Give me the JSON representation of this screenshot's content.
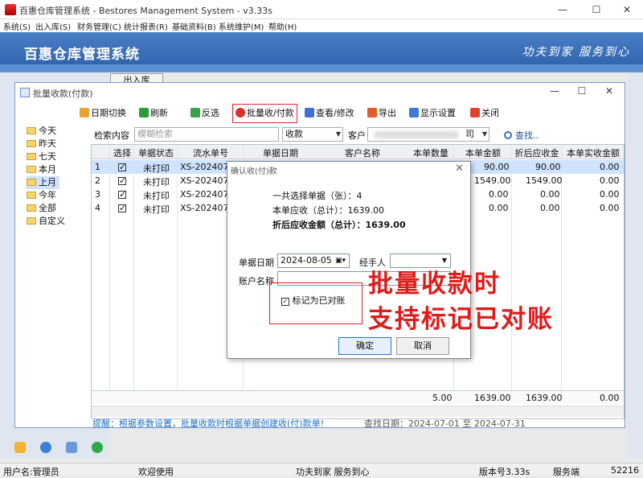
{
  "window": {
    "title": "百惠仓库管理系统 - Bestores Management System - v3.33s",
    "controls": [
      "—",
      "☐",
      "✕"
    ]
  },
  "menu": [
    "系统(S)",
    "出入库(S)",
    "财务管理(C)",
    "统计报表(R)",
    "基础资料(B)",
    "系统维护(M)",
    "帮助(H)"
  ],
  "banner": {
    "title": "百惠仓库管理系统",
    "slogan": "功夫到家 服务到心"
  },
  "tab_inbound": "出入库",
  "inner_window": {
    "title": "批量收款(付款)",
    "toolbar": [
      {
        "label": "日期切换",
        "icon": "calendar-icon",
        "color": "#e8a531"
      },
      {
        "label": "刷新",
        "icon": "refresh-icon",
        "color": "#2a9d3b"
      },
      {
        "label": "反选",
        "icon": "invert-icon",
        "color": "#3aa34a"
      },
      {
        "label": "批量收/付款",
        "icon": "batch-pay-icon",
        "color": "#d8312a"
      },
      {
        "label": "查看/修改",
        "icon": "view-edit-icon",
        "color": "#3f6fd1"
      },
      {
        "label": "导出",
        "icon": "export-icon",
        "color": "#e25b2a"
      },
      {
        "label": "显示设置",
        "icon": "settings-icon",
        "color": "#3a7bd5"
      },
      {
        "label": "关闭",
        "icon": "close-icon",
        "color": "#e0432f"
      }
    ],
    "tree": [
      "今天",
      "昨天",
      "七天",
      "本月",
      "上月",
      "今年",
      "全部",
      "自定义"
    ],
    "tree_active": "上月",
    "filter": {
      "search_label": "检索内容",
      "search_placeholder": "模糊检索",
      "type_value": "收款",
      "customer_label": "客户",
      "customer_value": "司",
      "search_btn": "查找.."
    },
    "grid": {
      "columns": [
        "选择",
        "单据状态",
        "流水单号",
        "单据日期",
        "客户名称",
        "本单数量",
        "本单金额",
        "折后应收金",
        "本单实收金额"
      ],
      "rows": [
        {
          "no": "1",
          "status": "未打印",
          "serial": "XS-20240700",
          "amount": "90.00",
          "discount": "90.00",
          "received": "0.00"
        },
        {
          "no": "2",
          "status": "未打印",
          "serial": "XS-20240700",
          "amount": "1549.00",
          "discount": "1549.00",
          "received": "0.00"
        },
        {
          "no": "3",
          "status": "未打印",
          "serial": "XS-20240700",
          "amount": "0.00",
          "discount": "0.00",
          "received": "0.00"
        },
        {
          "no": "4",
          "status": "未打印",
          "serial": "XS-20240700",
          "amount": "0.00",
          "discount": "0.00",
          "received": "0.00"
        }
      ],
      "totals": {
        "qty": "5.00",
        "amount": "1639.00",
        "discount": "1639.00",
        "received": "0.00"
      }
    },
    "hint": "提醒：根据参数设置，批量收款时根据单据创建收(付)款单!",
    "date_range": "查找日期：2024-07-01 至 2024-07-31"
  },
  "dialog": {
    "title": "确认收(付)款",
    "count_line": "一共选择单据（张）：4",
    "due_line": "本单应收（总计）：1639.00",
    "discount_line": "折后应收金额（总计）：1639.00",
    "date_label": "单据日期",
    "date_value": "2024-08-05",
    "handler_label": "经手人",
    "account_label": "账户名称",
    "mark_label": "标记为已对账",
    "ok": "确定",
    "cancel": "取消"
  },
  "annotation": [
    "批量收款时",
    "支持标记已对账"
  ],
  "status": {
    "user": "用户名:管理员",
    "welcome": "欢迎使用",
    "slogan": "功夫到家 服务到心",
    "version": "版本号3.33s",
    "service": "服务端",
    "port": "52216"
  },
  "colors": {
    "banner": "#2b5ea8",
    "accent_red": "#e01b1b",
    "selected_row": "#cfe3ff"
  }
}
